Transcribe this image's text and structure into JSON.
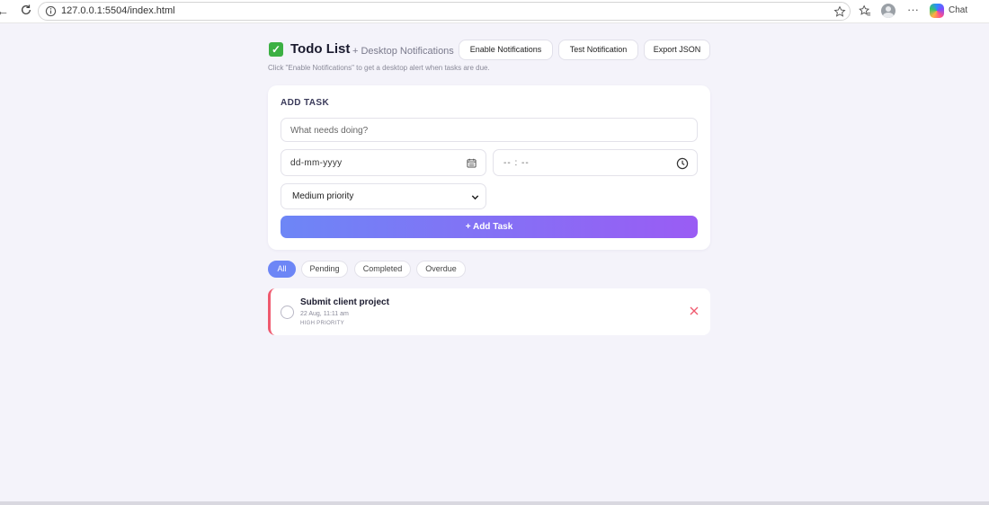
{
  "browser": {
    "url": "127.0.0.1:5504/index.html",
    "chat_label": "Chat",
    "more_label": "···"
  },
  "header": {
    "title": "Todo List",
    "subtitle": "+ Desktop Notifications",
    "enable_label": "Enable Notifications",
    "test_label": "Test Notification",
    "export_label": "Export JSON",
    "hint": "Click \"Enable Notifications\" to get a desktop alert when tasks are due."
  },
  "form": {
    "heading": "ADD TASK",
    "task_placeholder": "What needs doing?",
    "date_placeholder": "dd-mm-yyyy",
    "time_placeholder": "-- : --",
    "priority_value": "Medium priority",
    "add_label": "+ Add Task"
  },
  "filters": {
    "all": "All",
    "pending": "Pending",
    "completed": "Completed",
    "overdue": "Overdue"
  },
  "tasks": [
    {
      "title": "Submit client project",
      "due": "22 Aug, 11:11 am",
      "priority": "HIGH PRIORITY"
    }
  ],
  "colors": {
    "accent": "#6d86f6",
    "accent_end": "#9a5cf4",
    "high_priority": "#ef5a6f",
    "check_green": "#3cb043"
  },
  "icons": {
    "title": "check-box-icon",
    "date": "calendar-icon",
    "time": "clock-icon",
    "select": "chevron-down-icon",
    "delete": "close-icon"
  }
}
